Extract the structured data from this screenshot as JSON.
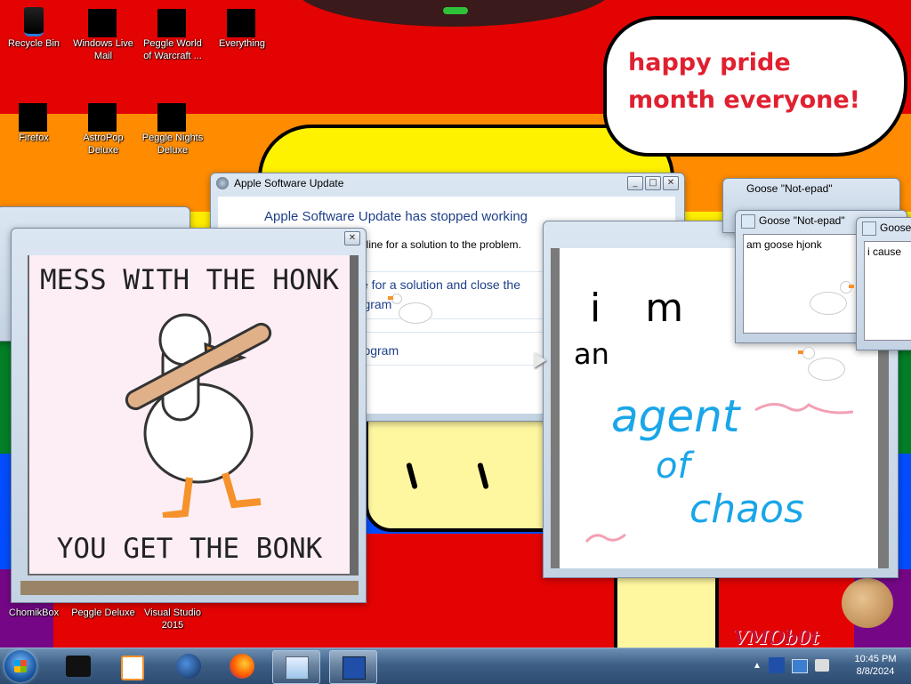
{
  "wallpaper": {
    "stripe_colors": [
      "#e40303",
      "#ff8c00",
      "#ffed00",
      "#008026",
      "#004dff",
      "#750787"
    ],
    "speech_bubble_text": "happy pride month everyone!",
    "signature": "VMOb0t"
  },
  "desktop_icons": [
    {
      "label": "Recycle Bin",
      "icon": "recycle-bin-icon"
    },
    {
      "label": "Windows Live Mail",
      "icon": "redacted-icon"
    },
    {
      "label": "Peggle World of Warcraft ...",
      "icon": "redacted-icon"
    },
    {
      "label": "Everything",
      "icon": "redacted-icon"
    },
    {
      "label": "Firefox",
      "icon": "redacted-icon"
    },
    {
      "label": "AstroPop Deluxe",
      "icon": "redacted-icon"
    },
    {
      "label": "Peggle Nights Deluxe",
      "icon": "redacted-icon"
    },
    {
      "label": "ChomikBox",
      "icon": "app-icon"
    },
    {
      "label": "Peggle Deluxe",
      "icon": "app-icon"
    },
    {
      "label": "Visual Studio 2015",
      "icon": "app-icon"
    }
  ],
  "apple_update_window": {
    "title": "Apple Software Update",
    "heading": "Apple Software Update has stopped working",
    "subtext": "nline for a solution to the problem.",
    "option1": "e for a solution and close the",
    "option1b": "rogram",
    "option2": "program"
  },
  "meme_window": {
    "top_text": "MESS WITH THE HONK",
    "bottom_text": "YOU GET THE BONK"
  },
  "drawing_window": {
    "line1": "i m",
    "line2": "an",
    "line3": "agent",
    "line4": "of",
    "line5": "chaos"
  },
  "notepad_windows": [
    {
      "title": "Goose \"Not-epad\"",
      "text": ""
    },
    {
      "title": "Goose \"Not-epad\"",
      "text": "am goose hjonk"
    },
    {
      "title": "Goose",
      "text": "i cause"
    }
  ],
  "taskbar": {
    "clock_time": "10:45 PM",
    "clock_date": "8/8/2024",
    "pinned": [
      "black-box-icon",
      "media-player-icon",
      "globe-icon",
      "firefox-icon",
      "notepad-icon",
      "update-icon"
    ]
  }
}
